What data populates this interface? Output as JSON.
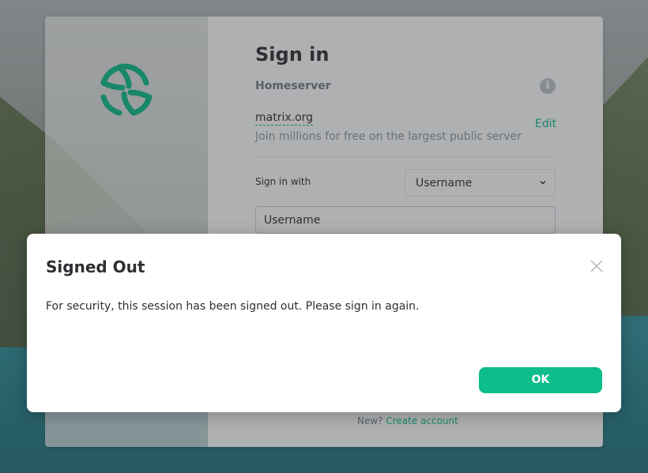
{
  "auth": {
    "title": "Sign in",
    "homeserver_label": "Homeserver",
    "info_icon": "i",
    "homeserver_name": "matrix.org",
    "homeserver_desc": "Join millions for free on the largest public server",
    "edit_label": "Edit",
    "signin_with_label": "Sign in with",
    "signin_with_value": "Username",
    "username_placeholder": "Username",
    "new_label": "New?",
    "create_account_label": "Create account"
  },
  "dialog": {
    "title": "Signed Out",
    "message": "For security, this session has been signed out. Please sign in again.",
    "ok_label": "OK"
  },
  "colors": {
    "accent": "#0dbd8b",
    "text": "#2e2f32",
    "muted": "#737d8c"
  },
  "icons": {
    "logo": "element-logo-icon",
    "info": "info-icon",
    "chevron": "chevron-down-icon",
    "close": "close-icon"
  }
}
